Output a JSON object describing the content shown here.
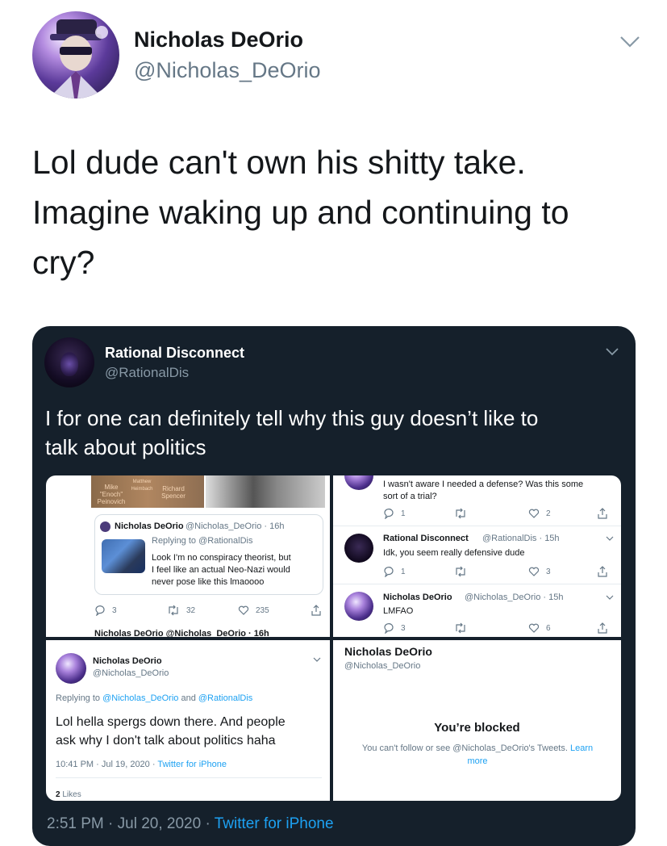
{
  "outer": {
    "name": "Nicholas DeOrio",
    "handle": "@Nicholas_DeOrio",
    "text_lines": [
      "Lol dude can't own his shitty take.",
      "Imagine waking up and continuing to",
      "cry?"
    ]
  },
  "embedded": {
    "name": "Rational Disconnect",
    "handle": "@RationalDis",
    "text_lines": [
      "I for one can definitely tell why this guy doesn’t like to",
      "talk about politics"
    ],
    "footer_time": "2:51 PM · Jul 20, 2020 · ",
    "footer_source": "Twitter for iPhone"
  },
  "panel1": {
    "photo_labels": [
      "Mike \"Enoch\" Peinovich",
      "Matthew Heimbach",
      "Richard Spencer"
    ],
    "quote_name": "Nicholas DeOrio",
    "quote_meta": "@Nicholas_DeOrio · 16h",
    "replying_to": "Replying to @RationalDis",
    "quote_lines": [
      "Look I'm no conspiracy theorist, but",
      "I feel like an actual Neo-Nazi would",
      "never pose like this lmaoooo"
    ],
    "actions": {
      "reply": "3",
      "retweet": "32",
      "like": "235"
    },
    "cut_line": "Nicholas DeOrio @Nicholas_DeOrio · 16h"
  },
  "panel2": {
    "top_lines": [
      "I wasn't aware I needed a defense? Was this some",
      "sort of a trial?"
    ],
    "top_actions": {
      "reply": "1",
      "like": "2"
    },
    "rd_name": "Rational Disconnect",
    "rd_meta": "@RationalDis · 15h",
    "rd_text": "Idk, you seem really defensive dude",
    "rd_actions": {
      "reply": "1",
      "like": "3"
    },
    "nd_name": "Nicholas DeOrio",
    "nd_meta": "@Nicholas_DeOrio · 15h",
    "nd_text": "LMFAO",
    "nd_actions": {
      "reply": "3",
      "like": "6"
    }
  },
  "panel3": {
    "name": "Nicholas DeOrio",
    "handle": "@Nicholas_DeOrio",
    "replying_prefix": "Replying to ",
    "replying_user1": "@Nicholas_DeOrio",
    "replying_and": " and ",
    "replying_user2": "@RationalDis",
    "text_lines": [
      "Lol hella spergs down there. And people",
      "ask why I don't talk about politics haha"
    ],
    "time": "10:41 PM · Jul 19, 2020 · ",
    "source": "Twitter for iPhone",
    "likes_count": "2",
    "likes_label": "Likes"
  },
  "panel4": {
    "name": "Nicholas DeOrio",
    "handle": "@Nicholas_DeOrio",
    "blocked_title": "You’re blocked",
    "blocked_line1": "You can't follow or see @Nicholas_DeOrio's Tweets. ",
    "learn": "Learn",
    "more": "more"
  },
  "colors": {
    "dark_bg": "#15202b",
    "link": "#1da1f2",
    "muted": "#657786",
    "dark_muted": "#8899a6"
  }
}
